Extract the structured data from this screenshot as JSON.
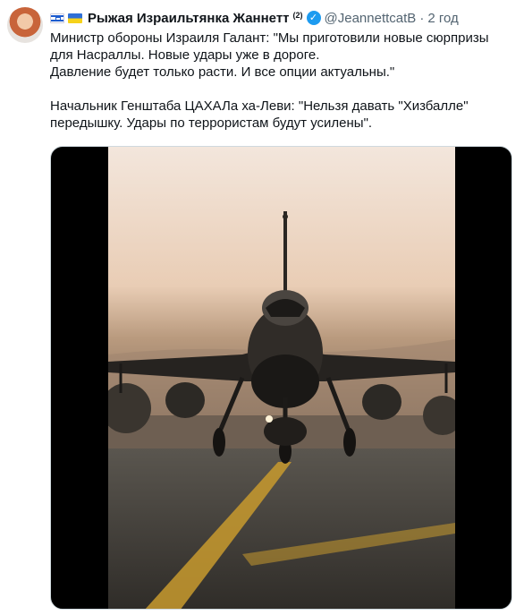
{
  "tweet": {
    "author_flag_1": "israel-flag-icon",
    "author_flag_2": "ukraine-flag-icon",
    "author_name": "Рыжая Израильтянка Жаннетт",
    "author_superscript": "(2)",
    "verified_icon": "verified-badge-icon",
    "handle": "@JeannettcatB",
    "separator": "·",
    "time": "2 год",
    "text": "Министр обороны Израиля Галант: \"Мы приготовили новые сюрпризы для Насраллы. Новые удары уже в дороге.\nДавление будет только расти. И все опции актуальны.\"\n\nНачальник Генштаба ЦАХАЛа ха-Леви: \"Нельзя давать \"Хизбалле\" передышку. Удары по террористам будут усилены\".",
    "media": {
      "type": "video",
      "subject": "fighter-jet-on-runway"
    }
  },
  "colors": {
    "text": "#0f1419",
    "muted": "#536471",
    "verified": "#1d9bf0"
  }
}
